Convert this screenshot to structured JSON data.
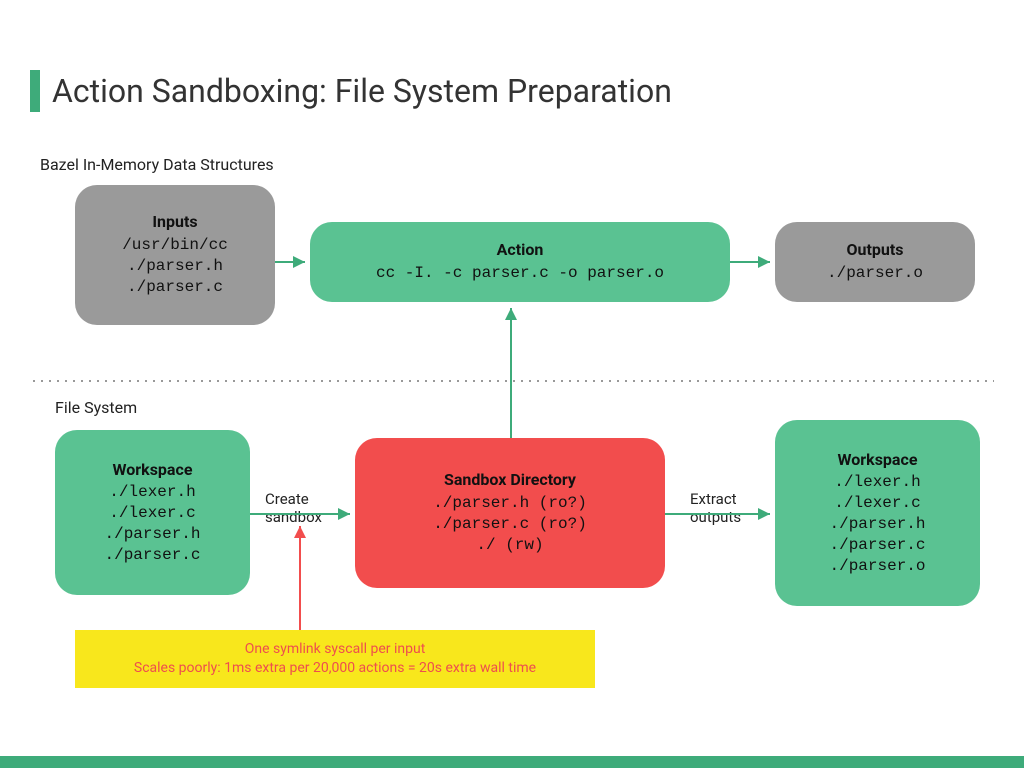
{
  "title": "Action Sandboxing: File System Preparation",
  "sections": {
    "top": "Bazel In-Memory Data Structures",
    "bottom": "File System"
  },
  "boxes": {
    "inputs": {
      "head": "Inputs",
      "body": "/usr/bin/cc\n./parser.h\n./parser.c"
    },
    "action": {
      "head": "Action",
      "body": "cc -I. -c parser.c -o parser.o"
    },
    "outputs": {
      "head": "Outputs",
      "body": "./parser.o"
    },
    "workspace1": {
      "head": "Workspace",
      "body": "./lexer.h\n./lexer.c\n./parser.h\n./parser.c"
    },
    "sandbox": {
      "head": "Sandbox Directory",
      "body": "./parser.h (ro?)\n./parser.c (ro?)\n./ (rw)"
    },
    "workspace2": {
      "head": "Workspace",
      "body": "./lexer.h\n./lexer.c\n./parser.h\n./parser.c\n./parser.o"
    }
  },
  "edges": {
    "create": "Create\nsandbox",
    "extract": "Extract\noutputs"
  },
  "note": {
    "line1": "One symlink syscall per input",
    "line2": "Scales poorly: 1ms extra per 20,000 actions = 20s extra wall time"
  },
  "colors": {
    "accent": "#3eab7a",
    "green": "#5ac292",
    "gray": "#9a9a9a",
    "red": "#f24d4d",
    "yellow": "#f8e71c",
    "arrow_green": "#3eab7a",
    "arrow_red": "#f24d4d"
  }
}
